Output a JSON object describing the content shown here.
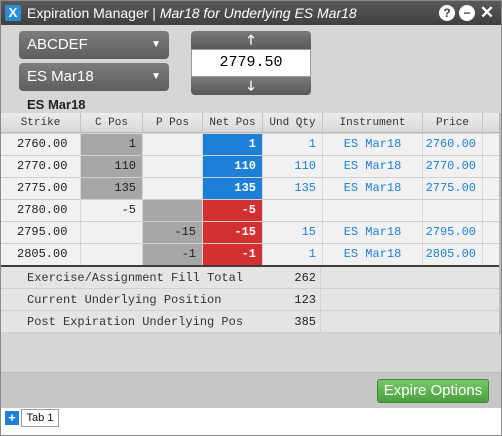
{
  "window": {
    "title": "Expiration Manager | ",
    "subtitle": "Mar18 for Underlying ES Mar18",
    "icons": [
      "help-icon",
      "minimize-icon",
      "close-icon"
    ]
  },
  "controls": {
    "account": "ABCDEF",
    "instrument": "ES Mar18",
    "price": "2779.50",
    "up_glyph": "🡑",
    "down_glyph": "🡓",
    "caret": "▼"
  },
  "section_label": "ES Mar18",
  "table": {
    "headers": [
      "Strike",
      "C Pos",
      "P Pos",
      "Net Pos",
      "Und Qty",
      "Instrument",
      "Price"
    ],
    "rows": [
      {
        "strike": "2760.00",
        "c_pos": "1",
        "p_pos": "",
        "net_pos": "1",
        "und_qty": "1",
        "instrument": "ES Mar18",
        "price": "2760.00"
      },
      {
        "strike": "2770.00",
        "c_pos": "110",
        "p_pos": "",
        "net_pos": "110",
        "und_qty": "110",
        "instrument": "ES Mar18",
        "price": "2770.00"
      },
      {
        "strike": "2775.00",
        "c_pos": "135",
        "p_pos": "",
        "net_pos": "135",
        "und_qty": "135",
        "instrument": "ES Mar18",
        "price": "2775.00"
      },
      {
        "strike": "2780.00",
        "c_pos": "-5",
        "p_pos": "",
        "net_pos": "-5",
        "und_qty": "",
        "instrument": "",
        "price": ""
      },
      {
        "strike": "2795.00",
        "c_pos": "",
        "p_pos": "-15",
        "net_pos": "-15",
        "und_qty": "15",
        "instrument": "ES Mar18",
        "price": "2795.00"
      },
      {
        "strike": "2805.00",
        "c_pos": "",
        "p_pos": "-1",
        "net_pos": "-1",
        "und_qty": "1",
        "instrument": "ES Mar18",
        "price": "2805.00"
      }
    ]
  },
  "summary": [
    {
      "label": "Exercise/Assignment Fill Total",
      "value": "262"
    },
    {
      "label": "Current Underlying Position",
      "value": "123"
    },
    {
      "label": "Post Expiration Underlying Pos",
      "value": "385"
    }
  ],
  "footer": {
    "expire_label": "Expire Options"
  },
  "tabs": {
    "add_glyph": "+",
    "items": [
      "Tab 1"
    ]
  },
  "colors": {
    "positive": "#1e7fd9",
    "negative": "#d33131",
    "accent_green": "#4a9f3e"
  }
}
